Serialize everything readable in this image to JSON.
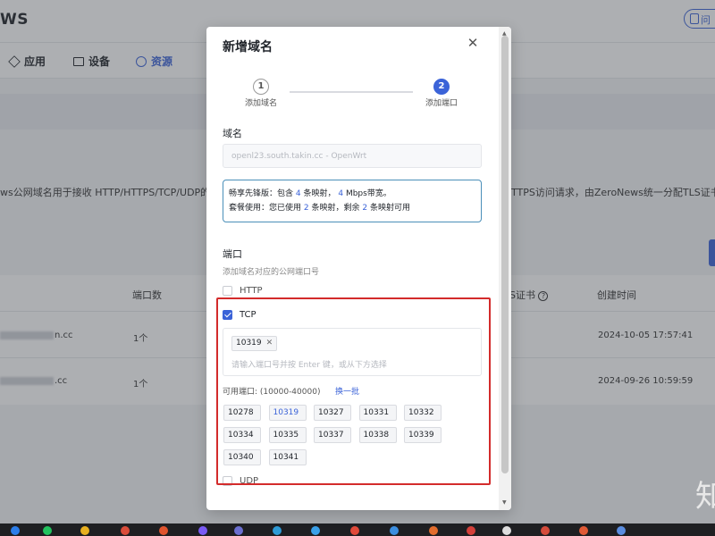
{
  "background": {
    "brand": "WS",
    "help_label": "问",
    "nav": [
      {
        "label": "应用",
        "icon": "cube-icon"
      },
      {
        "label": "设备",
        "icon": "monitor-icon"
      },
      {
        "label": "资源",
        "icon": "globe-icon"
      }
    ],
    "description_left": "ws公网域名用于接收 HTTP/HTTPS/TCP/UDP的",
    "description_right": "TTPS访问请求，由ZeroNews统一分配TLS证书，",
    "table": {
      "headers": {
        "ports": "端口数",
        "tls": "S证书",
        "created": "创建时间"
      },
      "rows": [
        {
          "domain_suffix": "n.cc",
          "ports": "1个",
          "created": "2024-10-05 17:57:41"
        },
        {
          "domain_suffix": ".cc",
          "ports": "1个",
          "created": "2024-09-26 10:59:59"
        }
      ]
    },
    "watermark": "知"
  },
  "modal": {
    "title": "新增域名",
    "steps": [
      {
        "number": "1",
        "label": "添加域名",
        "state": "done"
      },
      {
        "number": "2",
        "label": "添加端口",
        "state": "current"
      }
    ],
    "domain": {
      "label": "域名",
      "value": "openl23.south.takin.cc - OpenWrt"
    },
    "plan": {
      "line1_prefix": "畅享先锋版：包含 ",
      "line1_mappings": "4",
      "line1_mid": " 条映射， ",
      "line1_bw": "4",
      "line1_suffix": " Mbps带宽。",
      "line2_prefix": "套餐使用：您已使用 ",
      "line2_used": "2",
      "line2_mid": " 条映射，剩余 ",
      "line2_left": "2",
      "line2_suffix": " 条映射可用"
    },
    "ports": {
      "label": "端口",
      "hint": "添加域名对应的公网端口号",
      "protocols": [
        {
          "name": "HTTP",
          "checked": false
        },
        {
          "name": "TCP",
          "checked": true
        },
        {
          "name": "UDP",
          "checked": false
        }
      ],
      "selected_tag": "10319",
      "input_placeholder": "请输入端口号并按 Enter 键，或从下方选择",
      "available_label": "可用端口:",
      "available_range": "(10000-40000)",
      "refresh_label": "换一批",
      "options": [
        "10278",
        "10319",
        "10327",
        "10331",
        "10332",
        "10334",
        "10335",
        "10337",
        "10338",
        "10339",
        "10340",
        "10341"
      ],
      "selected_option": "10319"
    }
  },
  "colors": {
    "accent": "#3b63d8",
    "highlight_frame": "#d32b2b",
    "plan_border": "#4a8fb9"
  }
}
